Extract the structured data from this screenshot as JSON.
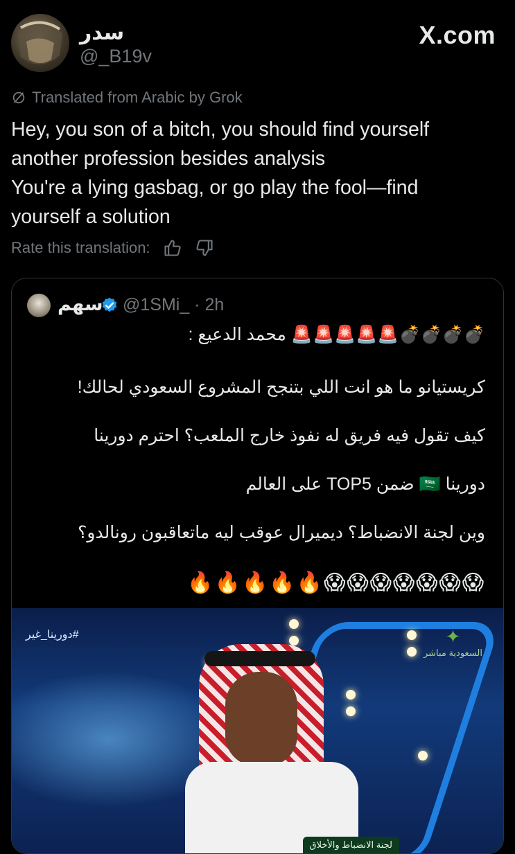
{
  "header": {
    "display_name": "سدر",
    "handle": "@_B19v",
    "brand": "X.com"
  },
  "translation": {
    "label": "Translated from Arabic by Grok",
    "lines": [
      "Hey, you son of a bitch, you should find yourself",
      "another profession besides analysis",
      "You're a lying gasbag, or go play the fool—find",
      "yourself a solution"
    ],
    "rate_label": "Rate this translation:"
  },
  "quoted": {
    "name": "سهم",
    "handle": "@1SMi_ · 2h",
    "lines": [
      "💣💣💣💣🚨🚨🚨🚨🚨 محمد الدعيع :",
      "كريستيانو ما هو انت اللي بتنجح المشروع السعودي لحالك!",
      "كيف تقول فيه فريق له نفوذ خارج الملعب؟ احترم دورينا",
      "دورينا 🇸🇦 ضمن TOP5 على العالم",
      "وين لجنة الانضباط؟ ديميرال عوقب ليه ماتعاقبون رونالدو؟",
      "😱😱😱😱😱😱😱🔥🔥🔥🔥🔥"
    ],
    "media": {
      "hashtag": "#دورينا_غير",
      "channel": "السعودية مباشر",
      "lower_third": "لجنة الانضباط والأخلاق"
    }
  },
  "colors": {
    "background": "#000000",
    "text": "#e7e9ea",
    "muted": "#71767b",
    "verified": "#1d9bf0"
  }
}
